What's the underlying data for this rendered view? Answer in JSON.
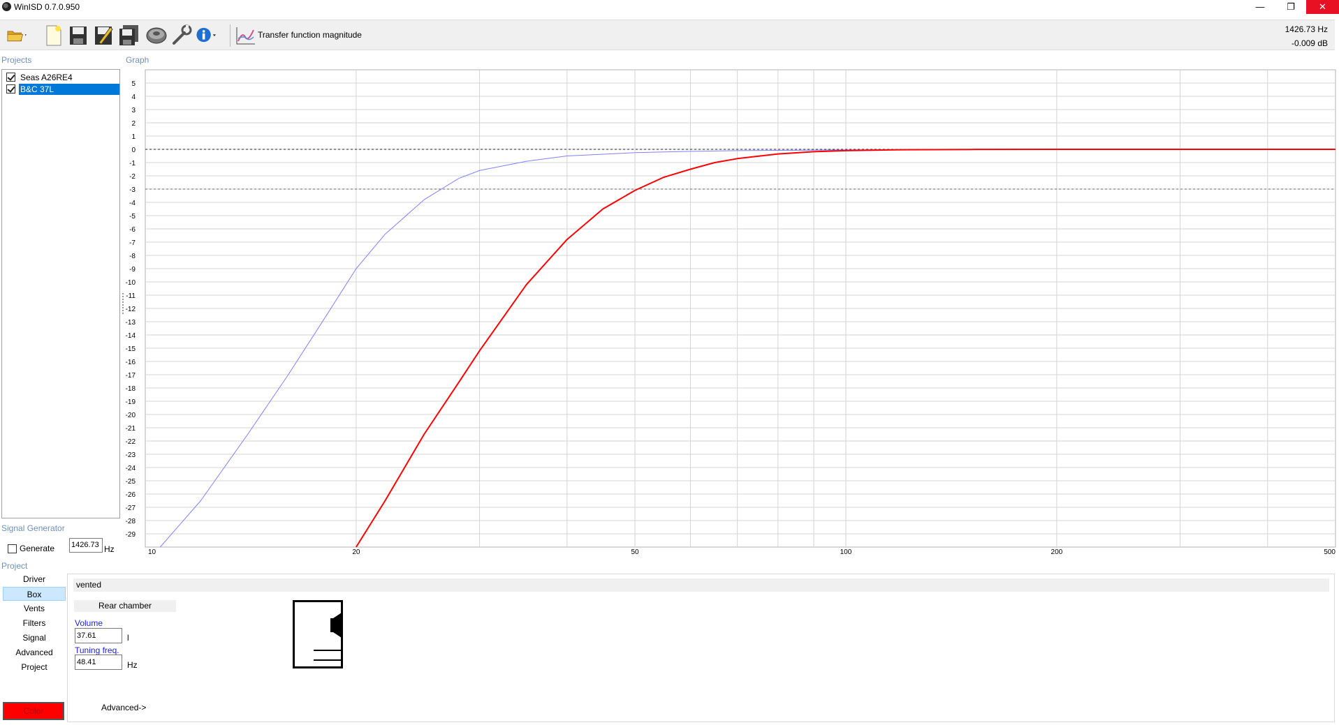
{
  "window": {
    "title": "WinISD 0.7.0.950",
    "minimize": "—",
    "maximize": "❐",
    "close": "✕"
  },
  "toolbar": {
    "icons": [
      "open-folder-icon",
      "new-project-icon",
      "save-icon",
      "save-as-icon",
      "save-all-icon",
      "driver-icon",
      "tools-icon",
      "info-icon"
    ],
    "graph_select": "Transfer function magnitude",
    "readout_freq": "1426.73 Hz",
    "readout_db": "-0.009 dB"
  },
  "labels": {
    "projects": "Projects",
    "graph": "Graph",
    "signal_generator": "Signal Generator",
    "project": "Project"
  },
  "projects": [
    {
      "name": "Seas A26RE4",
      "checked": true,
      "selected": false
    },
    {
      "name": "B&C 37L",
      "checked": true,
      "selected": true
    }
  ],
  "signal_generator": {
    "generate_label": "Generate",
    "frequency": "1426.73",
    "unit": "Hz"
  },
  "project_nav": {
    "items": [
      "Driver",
      "Box",
      "Vents",
      "Filters",
      "Signal",
      "Advanced",
      "Project"
    ],
    "active": "Box",
    "color_button": "Color"
  },
  "box": {
    "type": "vented",
    "rear_chamber_tab": "Rear chamber",
    "volume_label": "Volume",
    "volume_value": "37.61",
    "volume_unit": "l",
    "tuning_label": "Tuning freq.",
    "tuning_value": "48.41",
    "tuning_unit": "Hz",
    "advanced_link": "Advanced->"
  },
  "colors": {
    "series_blue": "#8080ff",
    "series_red": "#ff0000",
    "accent": "#0078d7",
    "section_label": "#6f8fbf"
  },
  "chart_data": {
    "type": "line",
    "xscale": "log",
    "xlim": [
      10,
      500
    ],
    "ylim": [
      -30,
      6
    ],
    "x_ticks": [
      10,
      20,
      50,
      100,
      200,
      500
    ],
    "y_ticks": [
      5,
      4,
      3,
      2,
      1,
      0,
      -1,
      -2,
      -3,
      -4,
      -5,
      -6,
      -7,
      -8,
      -9,
      -10,
      -11,
      -12,
      -13,
      -14,
      -15,
      -16,
      -17,
      -18,
      -19,
      -20,
      -21,
      -22,
      -23,
      -24,
      -25,
      -26,
      -27,
      -28,
      -29
    ],
    "reference_lines": [
      0,
      -3
    ],
    "grid": true,
    "series": [
      {
        "color": "#8080ff",
        "x": [
          10.5,
          12,
          14,
          16,
          18,
          20,
          22,
          25,
          28,
          30,
          35,
          40,
          50,
          60,
          70,
          80,
          100,
          120
        ],
        "y": [
          -30,
          -26.5,
          -21.5,
          -17,
          -12.8,
          -9,
          -6.4,
          -3.8,
          -2.2,
          -1.6,
          -0.9,
          -0.5,
          -0.25,
          -0.15,
          -0.1,
          -0.08,
          -0.05,
          -0.02
        ]
      },
      {
        "color": "#ff0000",
        "x": [
          20,
          22,
          25,
          28,
          30,
          35,
          40,
          45,
          50,
          55,
          60,
          65,
          70,
          80,
          90,
          100,
          120,
          150,
          200,
          300,
          500
        ],
        "y": [
          -30,
          -26.5,
          -21.5,
          -17.6,
          -15.2,
          -10.2,
          -6.8,
          -4.5,
          -3.1,
          -2.1,
          -1.5,
          -1.0,
          -0.7,
          -0.35,
          -0.18,
          -0.1,
          -0.03,
          -0.01,
          0,
          0,
          0
        ]
      }
    ]
  }
}
